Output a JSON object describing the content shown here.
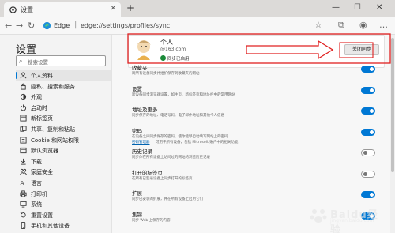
{
  "window": {
    "tab_title": "设置",
    "tab_close": "✕",
    "new_tab": "+",
    "minimize": "—",
    "maximize": "☐",
    "close": "✕"
  },
  "address_bar": {
    "back": "←",
    "forward": "→",
    "refresh": "↻",
    "brand": "Edge",
    "separator": "|",
    "url": "edge://settings/profiles/sync",
    "star": "☆",
    "collections": "⧉",
    "profile": "◉",
    "more": "…"
  },
  "sidebar": {
    "title": "设置",
    "search_placeholder": "搜索设置",
    "items": [
      {
        "label": "个人资料",
        "icon": "person-icon",
        "active": true
      },
      {
        "label": "隐私、搜索和服务",
        "icon": "lock-icon",
        "active": false
      },
      {
        "label": "外观",
        "icon": "appearance-icon",
        "active": false
      },
      {
        "label": "启动时",
        "icon": "power-icon",
        "active": false
      },
      {
        "label": "新标签页",
        "icon": "new-tab-icon",
        "active": false
      },
      {
        "label": "共享、复制和粘贴",
        "icon": "share-icon",
        "active": false
      },
      {
        "label": "Cookie 和网站权限",
        "icon": "site-permissions-icon",
        "active": false
      },
      {
        "label": "默认浏览器",
        "icon": "browser-icon",
        "active": false
      },
      {
        "label": "下载",
        "icon": "download-icon",
        "active": false
      },
      {
        "label": "家庭安全",
        "icon": "family-icon",
        "active": false
      },
      {
        "label": "语言",
        "icon": "language-icon",
        "active": false
      },
      {
        "label": "打印机",
        "icon": "printer-icon",
        "active": false
      },
      {
        "label": "系统",
        "icon": "system-icon",
        "active": false
      },
      {
        "label": "重置设置",
        "icon": "reset-icon",
        "active": false
      },
      {
        "label": "手机和其他设备",
        "icon": "phone-icon",
        "active": false
      }
    ]
  },
  "profile": {
    "name": "个人",
    "email": "@163.com",
    "sync_status": "同步已启用",
    "turn_off_button": "关闭同步"
  },
  "sync_items": [
    {
      "title": "收藏夹",
      "desc": "跨所有设备同步并维护保存到收藏夹的网站",
      "on": true
    },
    {
      "title": "设置",
      "desc": "跨设备同步浏览器设置，如主页、新标签页和地址栏中的常用网站",
      "on": true
    },
    {
      "title": "地址及更多",
      "desc": "同步保存的地址、电话号码、电子邮件地址和其他个人信息",
      "on": true
    },
    {
      "title": "密码",
      "desc": "在设备之间同步保存的密码，使你能够自动填写网站上的密码",
      "link": "密码管理器",
      "desc2": "可用于所有设备，包括 Microsoft 账户中的相关功能",
      "on": true
    },
    {
      "title": "历史记录",
      "desc": "同步你在所有设备上访问过的网站的浏览历史记录",
      "on": false
    },
    {
      "title": "打开的标签页",
      "desc": "在所有已登录设备上同步打开的标签页",
      "on": false
    },
    {
      "title": "扩展",
      "desc": "同步已安装的扩展，并在所有设备上启用它们",
      "on": true
    },
    {
      "title": "集锦",
      "desc": "同步 Web 上保存的内容",
      "on": true
    }
  ],
  "watermark": {
    "text": "Baidu经验",
    "sub": "jingyan.baidu.com"
  },
  "colors": {
    "accent": "#0078d4",
    "sync_green": "#1a8a39",
    "annotation_red": "#e02020"
  }
}
